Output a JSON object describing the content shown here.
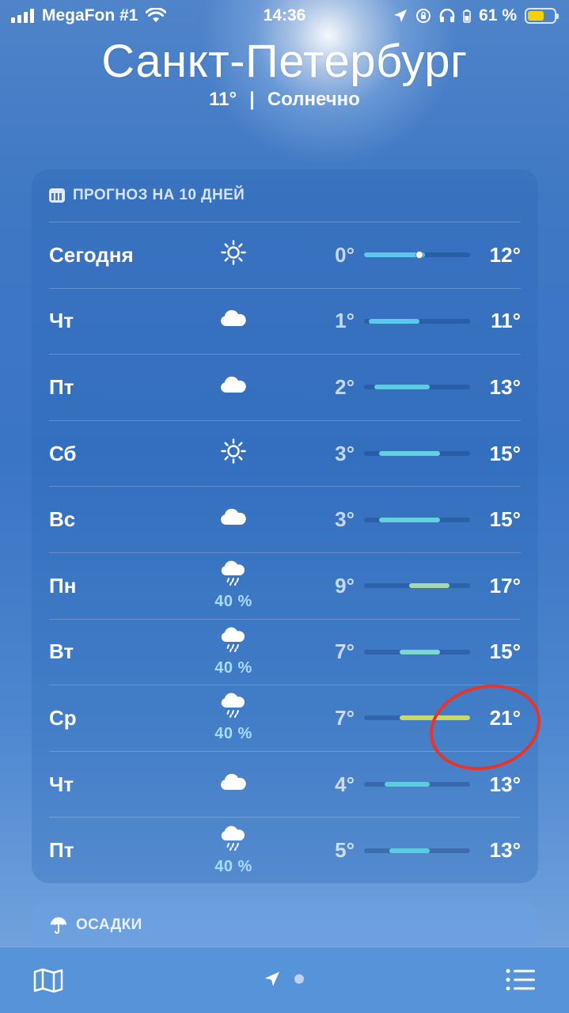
{
  "status_bar": {
    "carrier": "MegaFon #1",
    "time": "14:36",
    "battery_percent": "61 %",
    "battery_level": 0.61,
    "battery_color": "#f5d10b"
  },
  "header": {
    "city": "Санкт-Петербург",
    "temperature": "11°",
    "separator": "|",
    "condition": "Солнечно"
  },
  "forecast": {
    "title": "ПРОГНОЗ НА 10 ДНЕЙ",
    "scale": {
      "min": 0,
      "max": 21
    },
    "days": [
      {
        "day": "Сегодня",
        "icon": "sun-icon",
        "precip": "",
        "low": "0°",
        "high": "12°",
        "low_val": 0,
        "high_val": 12,
        "color": "#5bc8ec",
        "current_val": 11
      },
      {
        "day": "Чт",
        "icon": "cloud-icon",
        "precip": "",
        "low": "1°",
        "high": "11°",
        "low_val": 1,
        "high_val": 11,
        "color": "#5bc8ec"
      },
      {
        "day": "Пт",
        "icon": "cloud-icon",
        "precip": "",
        "low": "2°",
        "high": "13°",
        "low_val": 2,
        "high_val": 13,
        "color": "#5ccde0"
      },
      {
        "day": "Сб",
        "icon": "sun-icon",
        "precip": "",
        "low": "3°",
        "high": "15°",
        "low_val": 3,
        "high_val": 15,
        "color": "#62d2dc"
      },
      {
        "day": "Вс",
        "icon": "cloud-icon",
        "precip": "",
        "low": "3°",
        "high": "15°",
        "low_val": 3,
        "high_val": 15,
        "color": "#62d2dc"
      },
      {
        "day": "Пн",
        "icon": "rain-icon",
        "precip": "40 %",
        "low": "9°",
        "high": "17°",
        "low_val": 9,
        "high_val": 17,
        "color": "#a9d8a8"
      },
      {
        "day": "Вт",
        "icon": "rain-icon",
        "precip": "40 %",
        "low": "7°",
        "high": "15°",
        "low_val": 7,
        "high_val": 15,
        "color": "#7ad8cf"
      },
      {
        "day": "Ср",
        "icon": "rain-icon",
        "precip": "40 %",
        "low": "7°",
        "high": "21°",
        "low_val": 7,
        "high_val": 21,
        "color": "#c9d86a"
      },
      {
        "day": "Чт",
        "icon": "cloud-icon",
        "precip": "",
        "low": "4°",
        "high": "13°",
        "low_val": 4,
        "high_val": 13,
        "color": "#5ccde0"
      },
      {
        "day": "Пт",
        "icon": "rain-icon",
        "precip": "40 %",
        "low": "5°",
        "high": "13°",
        "low_val": 5,
        "high_val": 13,
        "color": "#5ccde0"
      }
    ]
  },
  "precipitation": {
    "title": "ОСАДКИ"
  },
  "toolbar": {
    "left_icon": "map-icon",
    "center_icon": "location-arrow-icon",
    "right_icon": "list-icon"
  }
}
